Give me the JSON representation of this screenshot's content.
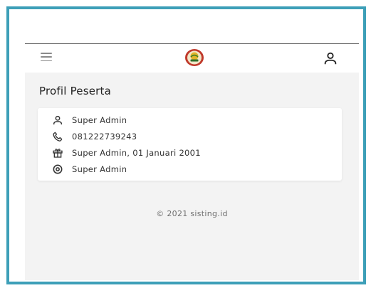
{
  "header": {
    "menu_icon": "hamburger-menu-icon",
    "logo": "app-logo",
    "user_icon": "user-icon"
  },
  "page": {
    "title": "Profil Peserta"
  },
  "profile": {
    "items": [
      {
        "icon": "user-icon",
        "label": "Super Admin"
      },
      {
        "icon": "phone-icon",
        "label": "081222739243"
      },
      {
        "icon": "gift-icon",
        "label": "Super Admin, 01 Januari 2001"
      },
      {
        "icon": "eye-icon",
        "label": "Super Admin"
      }
    ]
  },
  "footer": {
    "text": "© 2021 sisting.id"
  },
  "colors": {
    "frame_border": "#3d9fb8",
    "background": "#f3f3f3",
    "card": "#ffffff",
    "icon": "#333333"
  }
}
